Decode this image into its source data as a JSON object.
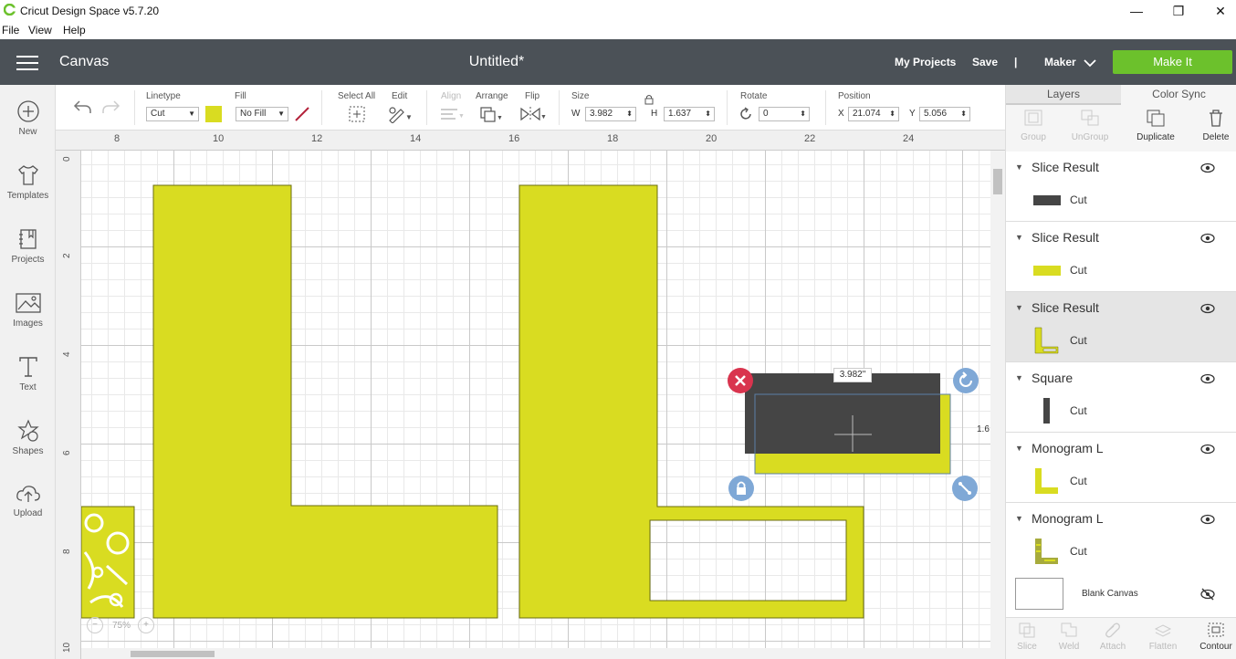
{
  "window": {
    "title": "Cricut Design Space  v5.7.20",
    "controls": [
      "—",
      "❐",
      "✕"
    ]
  },
  "menu": [
    "File",
    "View",
    "Help"
  ],
  "header": {
    "section": "Canvas",
    "document": "Untitled*",
    "my_projects": "My Projects",
    "save": "Save",
    "separator": "|",
    "machine": "Maker",
    "make_it": "Make It"
  },
  "sidebar": [
    {
      "label": "New",
      "icon": "plus-circle-icon"
    },
    {
      "label": "Templates",
      "icon": "tshirt-icon"
    },
    {
      "label": "Projects",
      "icon": "notebook-icon"
    },
    {
      "label": "Images",
      "icon": "image-icon"
    },
    {
      "label": "Text",
      "icon": "text-icon"
    },
    {
      "label": "Shapes",
      "icon": "shapes-icon"
    },
    {
      "label": "Upload",
      "icon": "upload-cloud-icon"
    }
  ],
  "toolbar": {
    "linetype_label": "Linetype",
    "linetype_value": "Cut",
    "linetype_color": "#d9dc21",
    "fill_label": "Fill",
    "fill_value": "No Fill",
    "select_all_label": "Select All",
    "edit_label": "Edit",
    "align_label": "Align",
    "arrange_label": "Arrange",
    "flip_label": "Flip",
    "size_label": "Size",
    "w_label": "W",
    "w_value": "3.982",
    "h_label": "H",
    "h_value": "1.637",
    "rotate_label": "Rotate",
    "rotate_value": "0",
    "position_label": "Position",
    "x_label": "X",
    "x_value": "21.074",
    "y_label": "Y",
    "y_value": "5.056"
  },
  "ruler": {
    "top": [
      "8",
      "10",
      "12",
      "14",
      "16",
      "18",
      "20",
      "22",
      "24"
    ],
    "left": [
      "0",
      "2",
      "4",
      "6",
      "8",
      "10"
    ]
  },
  "canvas": {
    "width_readout": "3.982\"",
    "height_readout": "1.6",
    "zoom": "75%",
    "shape_color": "#d9dc21",
    "dark_color": "#454545"
  },
  "panel": {
    "tabs": [
      "Layers",
      "Color Sync"
    ],
    "tools": [
      {
        "label": "Group",
        "enabled": false
      },
      {
        "label": "UnGroup",
        "enabled": false
      },
      {
        "label": "Duplicate",
        "enabled": true
      },
      {
        "label": "Delete",
        "enabled": true
      }
    ],
    "layers": [
      {
        "name": "Slice Result",
        "op": "Cut",
        "thumb": "dark-bar",
        "selected": false
      },
      {
        "name": "Slice Result",
        "op": "Cut",
        "thumb": "yellow-bar",
        "selected": false
      },
      {
        "name": "Slice Result",
        "op": "Cut",
        "thumb": "l-outline",
        "selected": true
      },
      {
        "name": "Square",
        "op": "Cut",
        "thumb": "dark-vertical",
        "selected": false
      },
      {
        "name": "Monogram L",
        "op": "Cut",
        "thumb": "l-yellow",
        "selected": false
      },
      {
        "name": "Monogram L",
        "op": "Cut",
        "thumb": "l-olive",
        "selected": false
      }
    ],
    "blank_canvas": "Blank Canvas",
    "bottom_tools": [
      {
        "label": "Slice",
        "enabled": false
      },
      {
        "label": "Weld",
        "enabled": false
      },
      {
        "label": "Attach",
        "enabled": false
      },
      {
        "label": "Flatten",
        "enabled": false
      },
      {
        "label": "Contour",
        "enabled": true
      }
    ]
  }
}
